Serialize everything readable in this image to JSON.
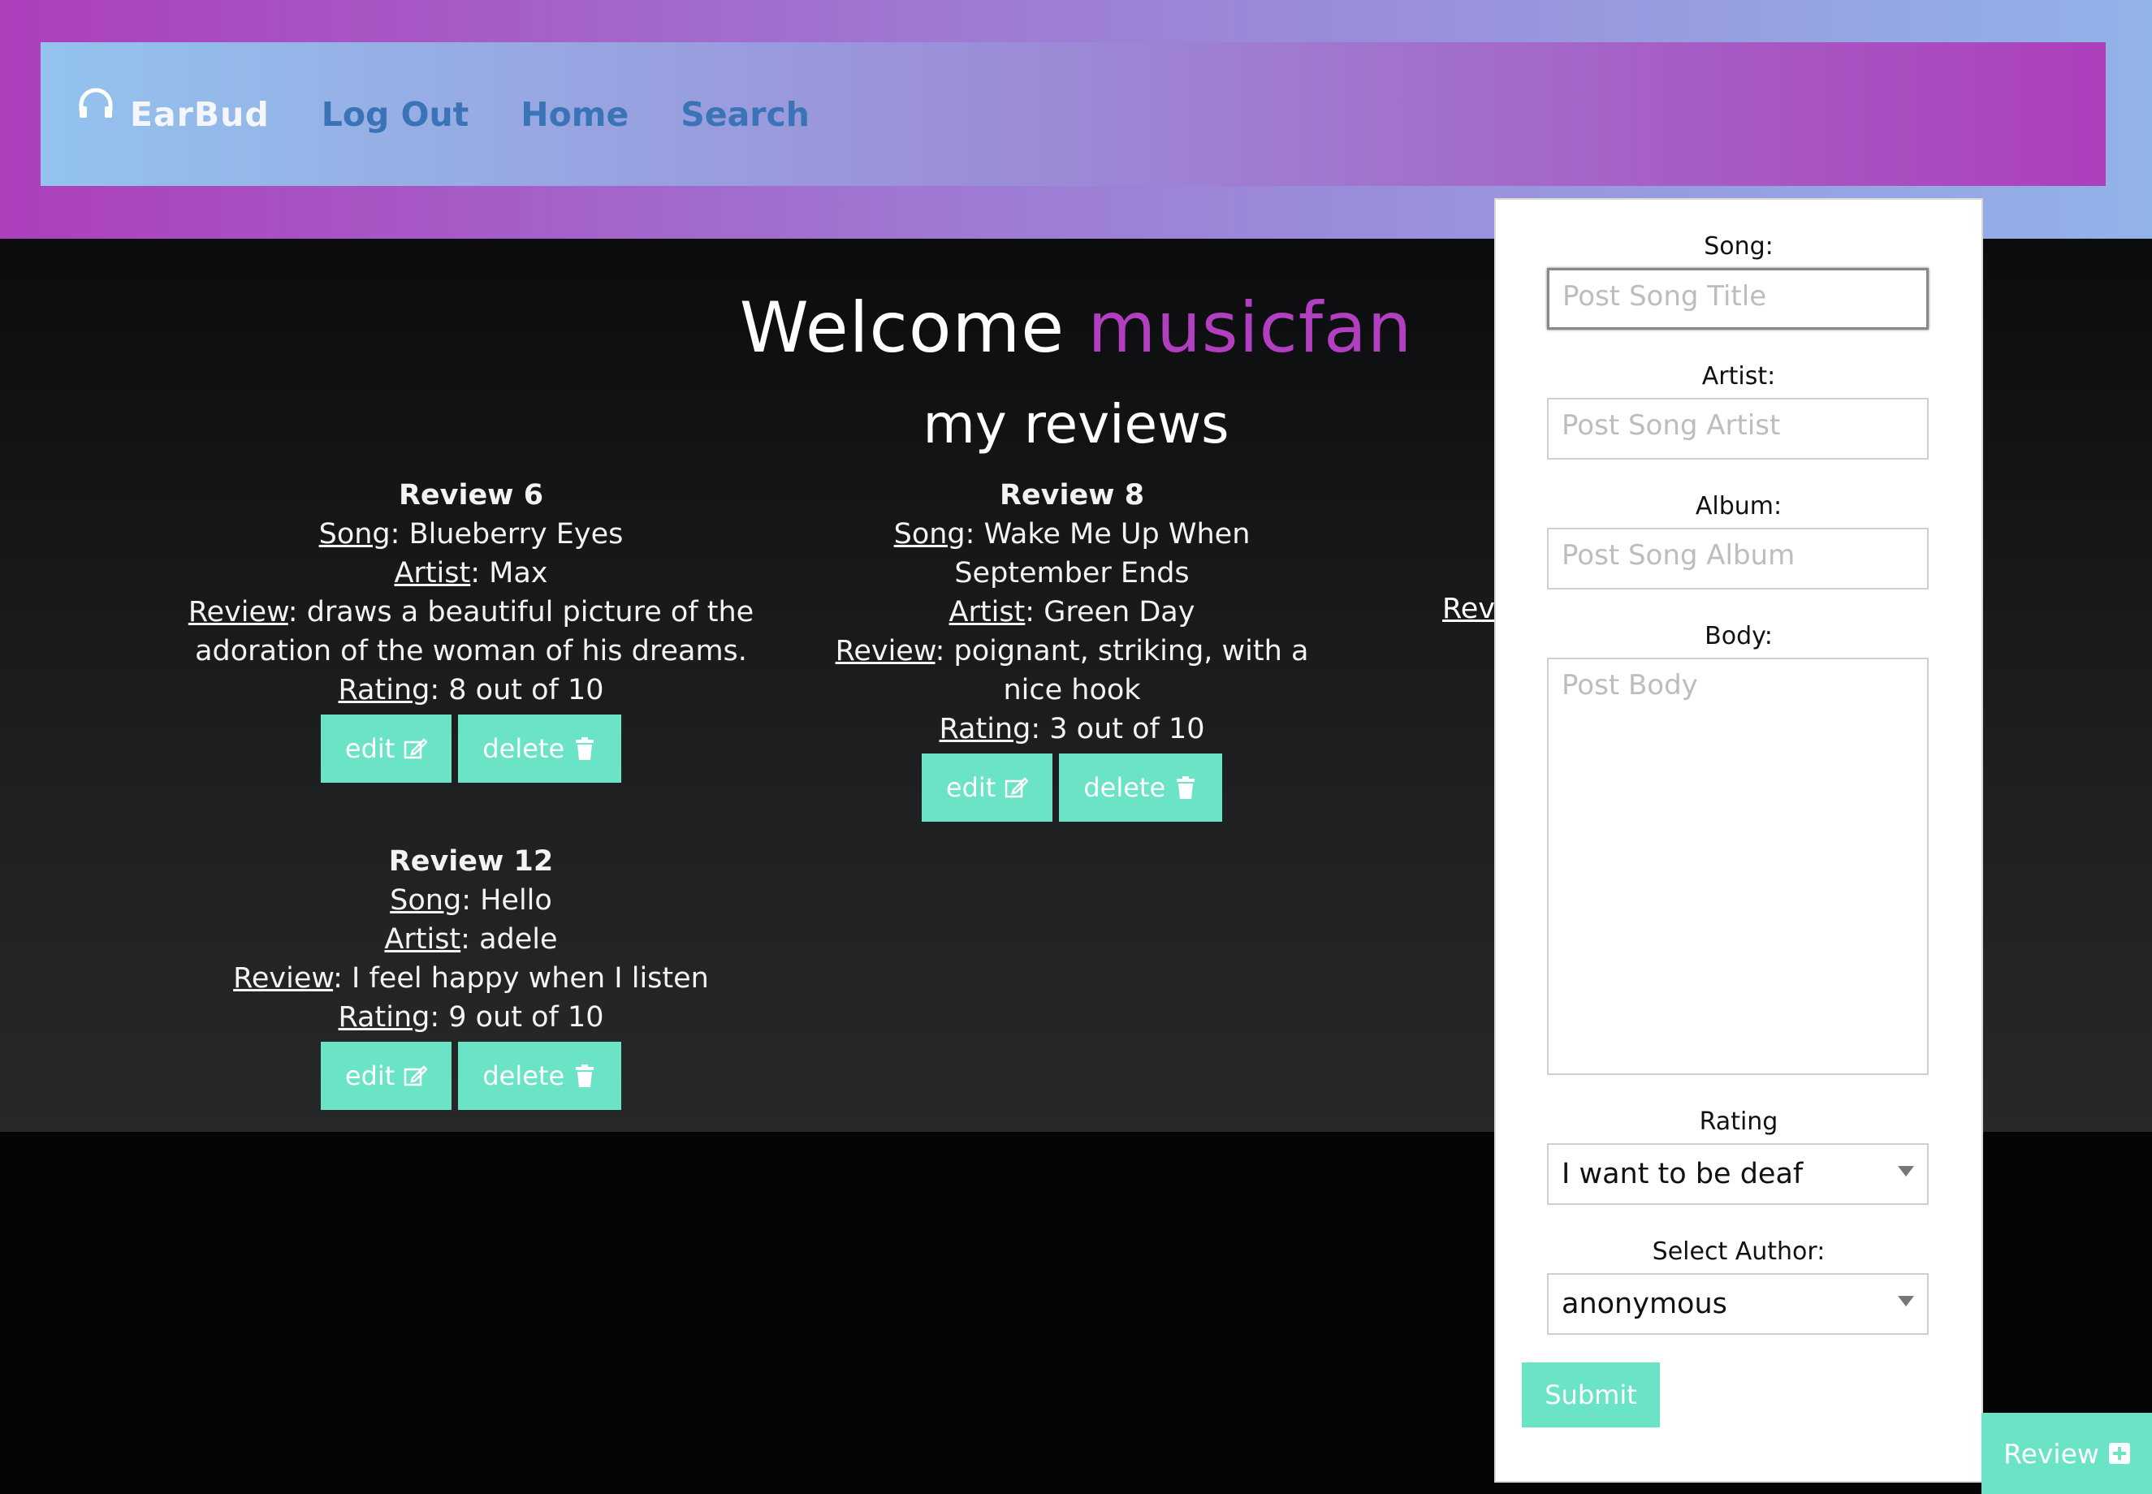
{
  "nav": {
    "brand": "EarBud",
    "links": [
      "Log Out",
      "Home",
      "Search"
    ]
  },
  "welcome": {
    "prefix": "Welcome",
    "username": "musicfan"
  },
  "section_title": "my reviews",
  "labels": {
    "song": "Song",
    "artist": "Artist",
    "review": "Review",
    "rating": "Rating"
  },
  "reviews": [
    {
      "title": "Review 6",
      "song": "Blueberry Eyes",
      "artist": "Max",
      "review": "draws a beautiful picture of the adoration of the woman of his dreams.",
      "rating": "8 out of 10"
    },
    {
      "title": "Review 8",
      "song": "Wake Me Up When September Ends",
      "artist": "Green Day",
      "review": "poignant, striking, with a nice hook",
      "rating": "3 out of 10"
    },
    {
      "title": "Review 12",
      "song": "Hello",
      "artist": "adele",
      "review": "I feel happy when I listen",
      "rating": "9 out of 10"
    }
  ],
  "partial_label": "Rev",
  "buttons": {
    "edit": "edit",
    "delete": "delete"
  },
  "form": {
    "song_label": "Song:",
    "song_placeholder": "Post Song Title",
    "artist_label": "Artist:",
    "artist_placeholder": "Post Song Artist",
    "album_label": "Album:",
    "album_placeholder": "Post Song Album",
    "body_label": "Body:",
    "body_placeholder": "Post Body",
    "rating_label": "Rating",
    "rating_value": "I want to be deaf",
    "author_label": "Select Author:",
    "author_value": "anonymous",
    "submit": "Submit"
  },
  "review_tab": "Review",
  "colors": {
    "accent": "#6be3c6",
    "username": "#b13fc0",
    "nav_link": "#3a74b6"
  }
}
